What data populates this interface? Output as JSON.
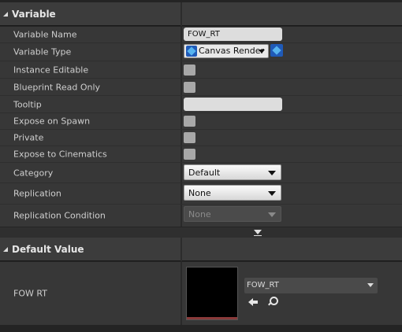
{
  "variable_section": {
    "title": "Variable",
    "rows": {
      "variable_name": {
        "label": "Variable Name",
        "value": "FOW_RT"
      },
      "variable_type": {
        "label": "Variable Type",
        "value": "Canvas Render"
      },
      "instance_editable": {
        "label": "Instance Editable"
      },
      "blueprint_read_only": {
        "label": "Blueprint Read Only"
      },
      "tooltip": {
        "label": "Tooltip",
        "value": ""
      },
      "expose_on_spawn": {
        "label": "Expose on Spawn"
      },
      "private": {
        "label": "Private"
      },
      "expose_to_cinematics": {
        "label": "Expose to Cinematics"
      },
      "category": {
        "label": "Category",
        "value": "Default"
      },
      "replication": {
        "label": "Replication",
        "value": "None"
      },
      "replication_condition": {
        "label": "Replication Condition",
        "value": "None"
      }
    }
  },
  "default_value_section": {
    "title": "Default Value",
    "property_label": "FOW RT",
    "asset_value": "FOW_RT"
  },
  "icons": [
    "triangle-expanded-icon",
    "struct-type-icon",
    "container-type-icon",
    "chevron-down-icon",
    "arrow-left-icon",
    "search-icon"
  ],
  "colors": {
    "panel_bg": "#242424",
    "row_bg": "#373737",
    "header_bg": "#3c3c3c",
    "type_icon": "#1f5ab8"
  }
}
